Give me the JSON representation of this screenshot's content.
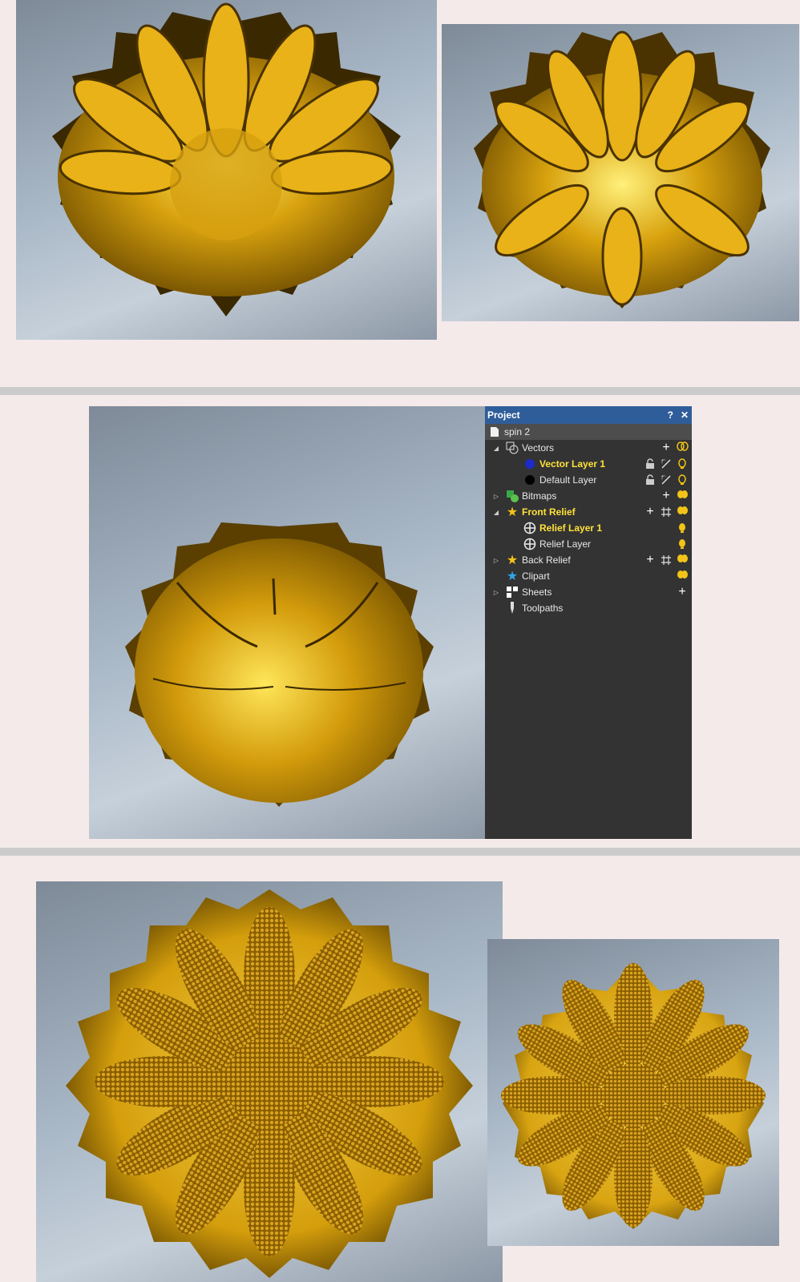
{
  "colors": {
    "accent": "#2f5d9a",
    "highlight": "#ffe13a",
    "bulb": "#f2c418",
    "gold": "#d9a514"
  },
  "panel": {
    "title": "Project",
    "help_icon": "?",
    "close_icon": "✕",
    "tree": {
      "root": "spin 2",
      "vectors": "Vectors",
      "vector_layer_1": "Vector Layer 1",
      "default_layer": "Default Layer",
      "bitmaps": "Bitmaps",
      "front_relief": "Front Relief",
      "relief_layer_1": "Relief Layer 1",
      "relief_layer": "Relief Layer",
      "back_relief": "Back Relief",
      "clipart": "Clipart",
      "sheets": "Sheets",
      "toolpaths": "Toolpaths"
    }
  }
}
